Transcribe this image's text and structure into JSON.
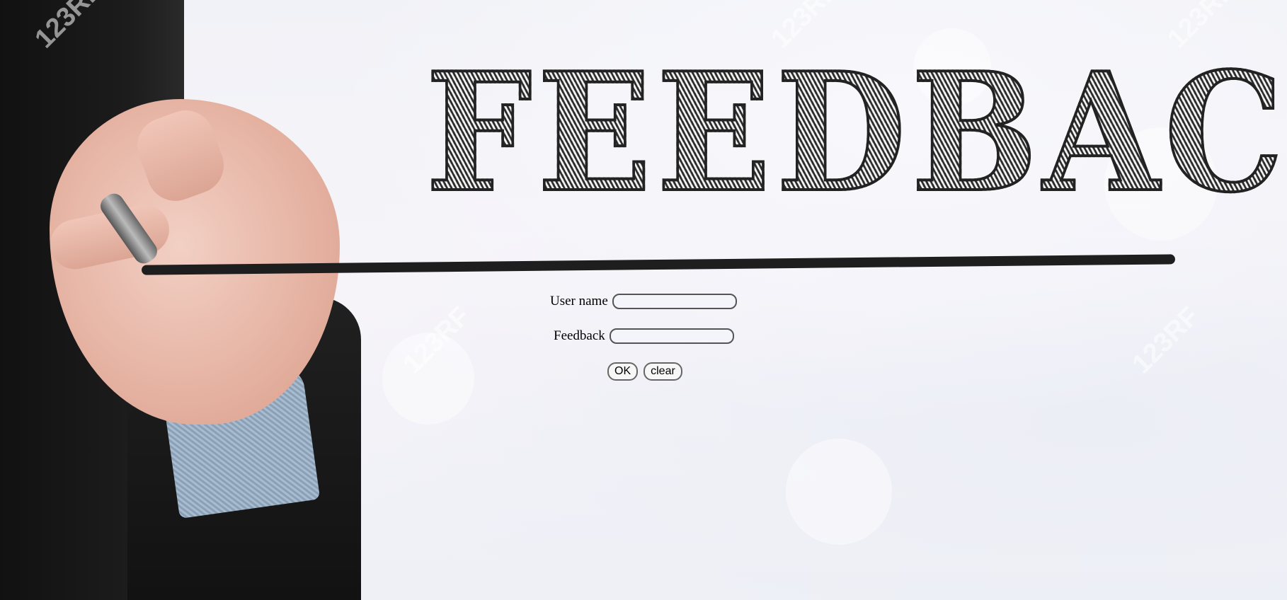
{
  "hero": {
    "title": "FEEDBACK",
    "watermark": "123RF"
  },
  "form": {
    "username": {
      "label": "User name",
      "value": "",
      "placeholder": ""
    },
    "feedback": {
      "label": "Feedback",
      "value": "",
      "placeholder": ""
    },
    "buttons": {
      "ok_label": "OK",
      "clear_label": "clear"
    }
  },
  "colors": {
    "background": "#f1f2f7",
    "ink": "#222222",
    "input_border": "#555555"
  }
}
